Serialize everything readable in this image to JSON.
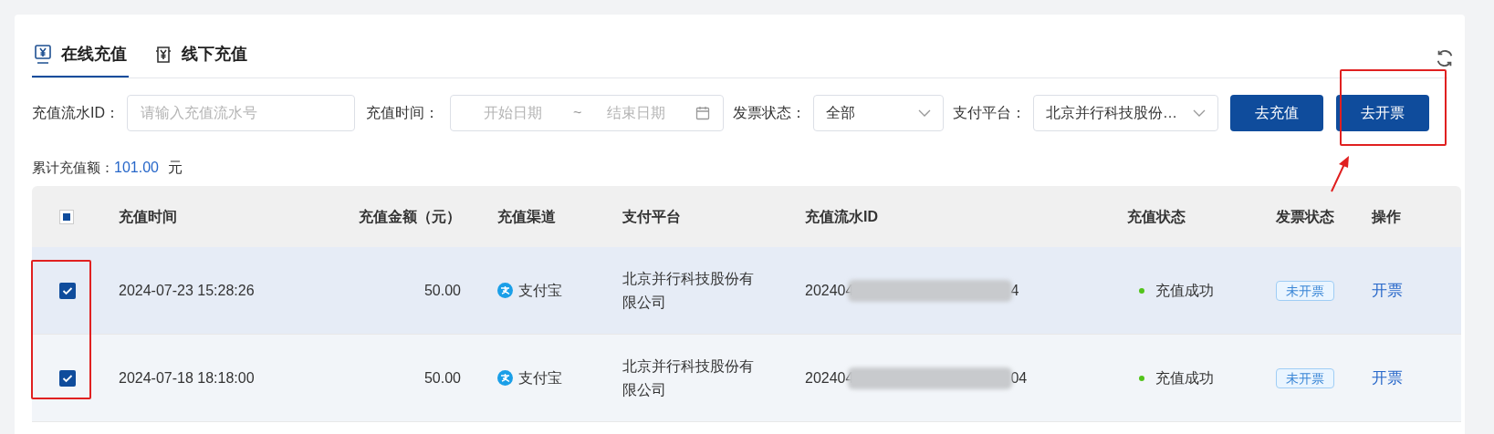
{
  "tabs": [
    {
      "label": "在线充值",
      "selected": true
    },
    {
      "label": "线下充值",
      "selected": false
    }
  ],
  "filters": {
    "id": {
      "label": "充值流水ID：",
      "placeholder": "请输入充值流水号"
    },
    "time": {
      "label": "充值时间：",
      "start_placeholder": "开始日期",
      "separator": "~",
      "end_placeholder": "结束日期"
    },
    "invoice_status": {
      "label": "发票状态：",
      "value": "全部"
    },
    "platform": {
      "label": "支付平台：",
      "value": "北京并行科技股份…"
    }
  },
  "buttons": [
    "去充值",
    "去开票"
  ],
  "total": {
    "label": "累计充值额：",
    "value": "101.00",
    "unit": "元"
  },
  "table": {
    "select_all_indeterminate": true,
    "columns": [
      "充值时间",
      "充值金额（元）",
      "充值渠道",
      "支付平台",
      "充值流水ID",
      "充值状态",
      "发票状态",
      "操作"
    ],
    "rows": [
      {
        "selected": true,
        "hovered": true,
        "time": "2024-07-23 15:28:26",
        "amount": "50.00",
        "channel": "支付宝",
        "platform": "北京并行科技股份有限公司",
        "id_start": "202404",
        "id_end": "4",
        "status": "充值成功",
        "color": "#52c41a",
        "invoice_status": "未开票",
        "action": "开票"
      },
      {
        "selected": true,
        "hovered": false,
        "time": "2024-07-18 18:18:00",
        "amount": "50.00",
        "channel": "支付宝",
        "platform": "北京并行科技股份有限公司",
        "id_start": "202404",
        "id_end": "04",
        "status": "充值成功",
        "color": "#52c41a",
        "invoice_status": "未开票",
        "action": "开票"
      }
    ]
  }
}
